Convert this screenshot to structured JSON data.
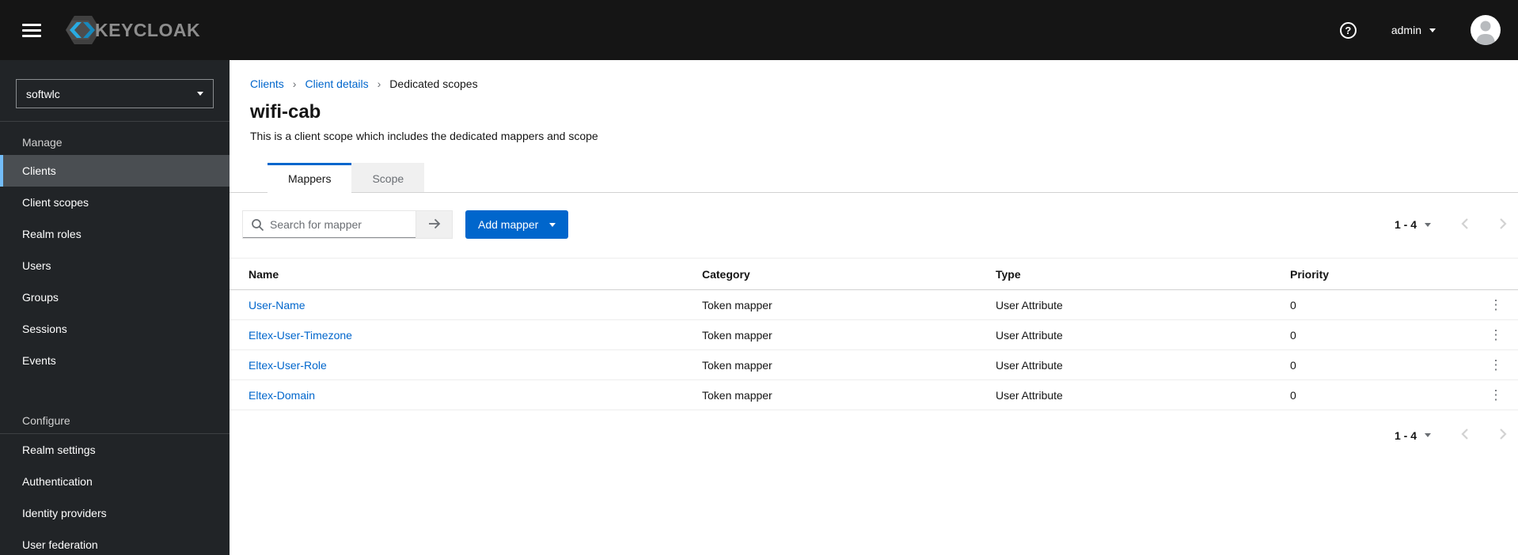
{
  "masthead": {
    "brand": "KEYCLOAK",
    "username": "admin"
  },
  "glyphs": {
    "question": "?",
    "breadcrumb_separator": "›",
    "kebab": "⋮"
  },
  "sidebar": {
    "realm": "softwlc",
    "sections": [
      {
        "title": "Manage",
        "items": [
          "Clients",
          "Client scopes",
          "Realm roles",
          "Users",
          "Groups",
          "Sessions",
          "Events"
        ]
      },
      {
        "title": "Configure",
        "items": [
          "Realm settings",
          "Authentication",
          "Identity providers",
          "User federation"
        ]
      }
    ]
  },
  "breadcrumb": {
    "items": [
      "Clients",
      "Client details",
      "Dedicated scopes"
    ]
  },
  "page": {
    "title": "wifi-cab",
    "subtitle": "This is a client scope which includes the dedicated mappers and scope"
  },
  "tabs": [
    {
      "label": "Mappers",
      "active": true
    },
    {
      "label": "Scope",
      "active": false
    }
  ],
  "toolbar": {
    "search_placeholder": "Search for mapper",
    "add_button": "Add mapper"
  },
  "pagination": {
    "range": "1 - 4"
  },
  "table": {
    "columns": [
      "Name",
      "Category",
      "Type",
      "Priority"
    ],
    "rows": [
      {
        "name": "User-Name",
        "category": "Token mapper",
        "type": "User Attribute",
        "priority": "0"
      },
      {
        "name": "Eltex-User-Timezone",
        "category": "Token mapper",
        "type": "User Attribute",
        "priority": "0"
      },
      {
        "name": "Eltex-User-Role",
        "category": "Token mapper",
        "type": "User Attribute",
        "priority": "0"
      },
      {
        "name": "Eltex-Domain",
        "category": "Token mapper",
        "type": "User Attribute",
        "priority": "0"
      }
    ]
  },
  "colors": {
    "masthead_bg": "#151515",
    "sidebar_bg": "#212427",
    "active_nav_bg": "#4a4e52",
    "active_nav_border": "#73bcf7",
    "primary_blue": "#0066cc",
    "link_blue": "#0066cc",
    "logo_cyan": "#29abe2",
    "muted_text": "#6a6e73"
  }
}
